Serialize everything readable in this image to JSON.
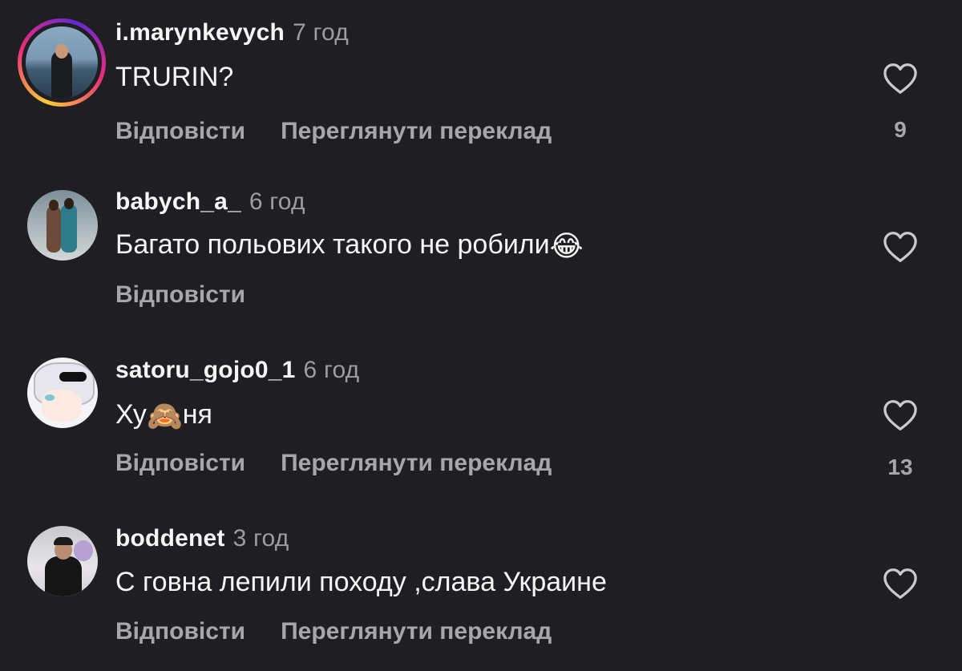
{
  "comments": [
    {
      "username": "i.marynkevych",
      "time": "7 год",
      "text": "TRURIN?",
      "reply_label": "Відповісти",
      "translate_label": "Переглянути переклад",
      "likes": "9",
      "has_story_ring": true
    },
    {
      "username": "babych_a_",
      "time": "6 год",
      "text": "Багато польових такого не робили",
      "emoji": "😂",
      "reply_label": "Відповісти",
      "has_story_ring": false
    },
    {
      "username": "satoru_gojo0_1",
      "time": "6 год",
      "text_start": "Ху",
      "emoji": "🙈",
      "text_end": "ня",
      "reply_label": "Відповісти",
      "translate_label": "Переглянути переклад",
      "likes": "13",
      "has_story_ring": false
    },
    {
      "username": "boddenet",
      "time": "3 год",
      "text": "С говна лепили походу ,слава Украине",
      "reply_label": "Відповісти",
      "translate_label": "Переглянути переклад",
      "has_story_ring": false
    }
  ],
  "icons": {
    "like": "heart-outline-icon"
  },
  "colors": {
    "background": "#1f1f23",
    "text_primary": "#f5f5f5",
    "text_secondary": "#9c9ca3",
    "action_text": "#a6a6ad"
  }
}
